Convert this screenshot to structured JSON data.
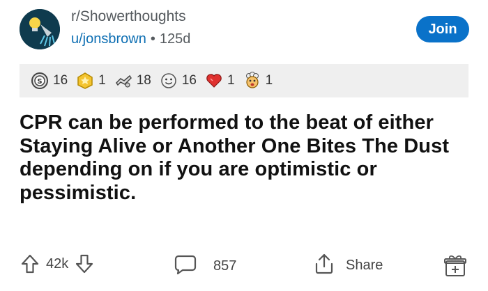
{
  "post": {
    "subreddit": "r/Showerthoughts",
    "author": "u/jonsbrown",
    "separator": "•",
    "age": "125d",
    "join_label": "Join",
    "title": "CPR can be performed to the beat of either Staying Alive or Another One Bites The Dust depending on if you are optimistic or pessimistic."
  },
  "awards": [
    {
      "icon": "silver-award-icon",
      "count": "16"
    },
    {
      "icon": "gold-award-icon",
      "count": "1"
    },
    {
      "icon": "helpful-award-icon",
      "count": "18"
    },
    {
      "icon": "wholesome-award-icon",
      "count": "16"
    },
    {
      "icon": "heart-award-icon",
      "count": "1"
    },
    {
      "icon": "mind-blown-award-icon",
      "count": "1"
    }
  ],
  "actions": {
    "upvotes": "42k",
    "comments": "857",
    "share_label": "Share"
  },
  "colors": {
    "join": "#0a72c9",
    "link": "#0e6fb3",
    "award_bar": "#efefef"
  }
}
